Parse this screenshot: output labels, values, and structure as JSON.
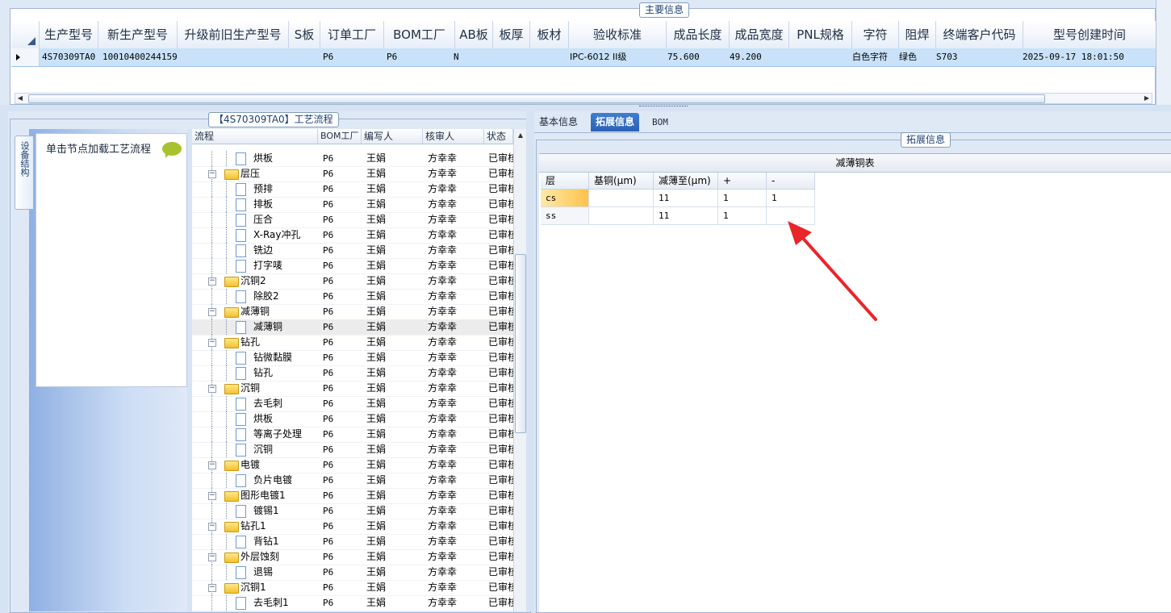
{
  "main_info": {
    "group_title": "主要信息",
    "columns": [
      "生产型号",
      "新生产型号",
      "升级前旧生产型号",
      "S板",
      "订单工厂",
      "BOM工厂",
      "AB板",
      "板厚",
      "板材",
      "验收标准",
      "成品长度",
      "成品宽度",
      "PNL规格",
      "字符",
      "阻焊",
      "终端客户代码",
      "型号创建时间"
    ],
    "row": {
      "prod_model": "4S70309TA0",
      "new_model": "10010400244159",
      "old_model": "",
      "s_board": "",
      "order_factory": "P6",
      "bom_factory": "P6",
      "ab_board": "N",
      "thickness": "",
      "material": "",
      "accept_std": "IPC-6012 II级",
      "length": "75.600",
      "width": "49.200",
      "pnl": "",
      "silkscreen": "白色字符",
      "soldermask": "绿色",
      "customer_code": "S703",
      "created": "2025-09-17 18:01:50"
    }
  },
  "process": {
    "group_title": "【4S70309TA0】工艺流程",
    "side_tab": "设备结构",
    "tree_hint": "单击节点加载工艺流程",
    "headers": {
      "flow": "流程",
      "bom": "BOM工厂",
      "writer": "编写人",
      "reviewer": "核审人",
      "status": "状态"
    },
    "rows": [
      {
        "name": "烘板",
        "level": 2,
        "folder": false,
        "bom": "P6",
        "writer": "王娟",
        "reviewer": "方幸幸",
        "status": "已审核"
      },
      {
        "name": "层压",
        "level": 1,
        "folder": true,
        "bom": "P6",
        "writer": "王娟",
        "reviewer": "方幸幸",
        "status": "已审核"
      },
      {
        "name": "预排",
        "level": 2,
        "folder": false,
        "bom": "P6",
        "writer": "王娟",
        "reviewer": "方幸幸",
        "status": "已审核"
      },
      {
        "name": "排板",
        "level": 2,
        "folder": false,
        "bom": "P6",
        "writer": "王娟",
        "reviewer": "方幸幸",
        "status": "已审核"
      },
      {
        "name": "压合",
        "level": 2,
        "folder": false,
        "bom": "P6",
        "writer": "王娟",
        "reviewer": "方幸幸",
        "status": "已审核"
      },
      {
        "name": "X-Ray冲孔",
        "level": 2,
        "folder": false,
        "bom": "P6",
        "writer": "王娟",
        "reviewer": "方幸幸",
        "status": "已审核"
      },
      {
        "name": "铣边",
        "level": 2,
        "folder": false,
        "bom": "P6",
        "writer": "王娟",
        "reviewer": "方幸幸",
        "status": "已审核"
      },
      {
        "name": "打字唛",
        "level": 2,
        "folder": false,
        "bom": "P6",
        "writer": "王娟",
        "reviewer": "方幸幸",
        "status": "已审核"
      },
      {
        "name": "沉铜2",
        "level": 1,
        "folder": true,
        "bom": "P6",
        "writer": "王娟",
        "reviewer": "方幸幸",
        "status": "已审核"
      },
      {
        "name": "除胶2",
        "level": 2,
        "folder": false,
        "bom": "P6",
        "writer": "王娟",
        "reviewer": "方幸幸",
        "status": "已审核"
      },
      {
        "name": "减薄铜",
        "level": 1,
        "folder": true,
        "bom": "P6",
        "writer": "王娟",
        "reviewer": "方幸幸",
        "status": "已审核"
      },
      {
        "name": "减薄铜",
        "level": 2,
        "folder": false,
        "bom": "P6",
        "writer": "王娟",
        "reviewer": "方幸幸",
        "status": "已审核",
        "selected": true
      },
      {
        "name": "钻孔",
        "level": 1,
        "folder": true,
        "bom": "P6",
        "writer": "王娟",
        "reviewer": "方幸幸",
        "status": "已审核"
      },
      {
        "name": "钻微黏膜",
        "level": 2,
        "folder": false,
        "bom": "P6",
        "writer": "王娟",
        "reviewer": "方幸幸",
        "status": "已审核"
      },
      {
        "name": "钻孔",
        "level": 2,
        "folder": false,
        "bom": "P6",
        "writer": "王娟",
        "reviewer": "方幸幸",
        "status": "已审核"
      },
      {
        "name": "沉铜",
        "level": 1,
        "folder": true,
        "bom": "P6",
        "writer": "王娟",
        "reviewer": "方幸幸",
        "status": "已审核"
      },
      {
        "name": "去毛刺",
        "level": 2,
        "folder": false,
        "bom": "P6",
        "writer": "王娟",
        "reviewer": "方幸幸",
        "status": "已审核"
      },
      {
        "name": "烘板",
        "level": 2,
        "folder": false,
        "bom": "P6",
        "writer": "王娟",
        "reviewer": "方幸幸",
        "status": "已审核"
      },
      {
        "name": "等离子处理",
        "level": 2,
        "folder": false,
        "bom": "P6",
        "writer": "王娟",
        "reviewer": "方幸幸",
        "status": "已审核"
      },
      {
        "name": "沉铜",
        "level": 2,
        "folder": false,
        "bom": "P6",
        "writer": "王娟",
        "reviewer": "方幸幸",
        "status": "已审核"
      },
      {
        "name": "电镀",
        "level": 1,
        "folder": true,
        "bom": "P6",
        "writer": "王娟",
        "reviewer": "方幸幸",
        "status": "已审核"
      },
      {
        "name": "负片电镀",
        "level": 2,
        "folder": false,
        "bom": "P6",
        "writer": "王娟",
        "reviewer": "方幸幸",
        "status": "已审核"
      },
      {
        "name": "图形电镀1",
        "level": 1,
        "folder": true,
        "bom": "P6",
        "writer": "王娟",
        "reviewer": "方幸幸",
        "status": "已审核"
      },
      {
        "name": "镀锡1",
        "level": 2,
        "folder": false,
        "bom": "P6",
        "writer": "王娟",
        "reviewer": "方幸幸",
        "status": "已审核"
      },
      {
        "name": "钻孔1",
        "level": 1,
        "folder": true,
        "bom": "P6",
        "writer": "王娟",
        "reviewer": "方幸幸",
        "status": "已审核"
      },
      {
        "name": "背钻1",
        "level": 2,
        "folder": false,
        "bom": "P6",
        "writer": "王娟",
        "reviewer": "方幸幸",
        "status": "已审核"
      },
      {
        "name": "外层蚀刻",
        "level": 1,
        "folder": true,
        "bom": "P6",
        "writer": "王娟",
        "reviewer": "方幸幸",
        "status": "已审核"
      },
      {
        "name": "退锡",
        "level": 2,
        "folder": false,
        "bom": "P6",
        "writer": "王娟",
        "reviewer": "方幸幸",
        "status": "已审核"
      },
      {
        "name": "沉铜1",
        "level": 1,
        "folder": true,
        "bom": "P6",
        "writer": "王娟",
        "reviewer": "方幸幸",
        "status": "已审核"
      },
      {
        "name": "去毛刺1",
        "level": 2,
        "folder": false,
        "bom": "P6",
        "writer": "王娟",
        "reviewer": "方幸幸",
        "status": "已审核"
      }
    ]
  },
  "right": {
    "tabs": [
      "基本信息",
      "拓展信息",
      "BOM"
    ],
    "active_tab": "拓展信息",
    "group_title": "拓展信息",
    "table_title": "减薄铜表",
    "headers": [
      "层",
      "基铜(μm)",
      "减薄至(μm)",
      "+",
      "-"
    ],
    "rows": [
      {
        "layer": "cs",
        "base": "",
        "thin_to": "11",
        "plus": "1",
        "minus": "1"
      },
      {
        "layer": "ss",
        "base": "",
        "thin_to": "11",
        "plus": "1",
        "minus": ""
      }
    ]
  },
  "colors": {
    "accent": "#2a62b3",
    "annotation_arrow": "#e8262a",
    "selected_row": "#c9e2f9"
  }
}
